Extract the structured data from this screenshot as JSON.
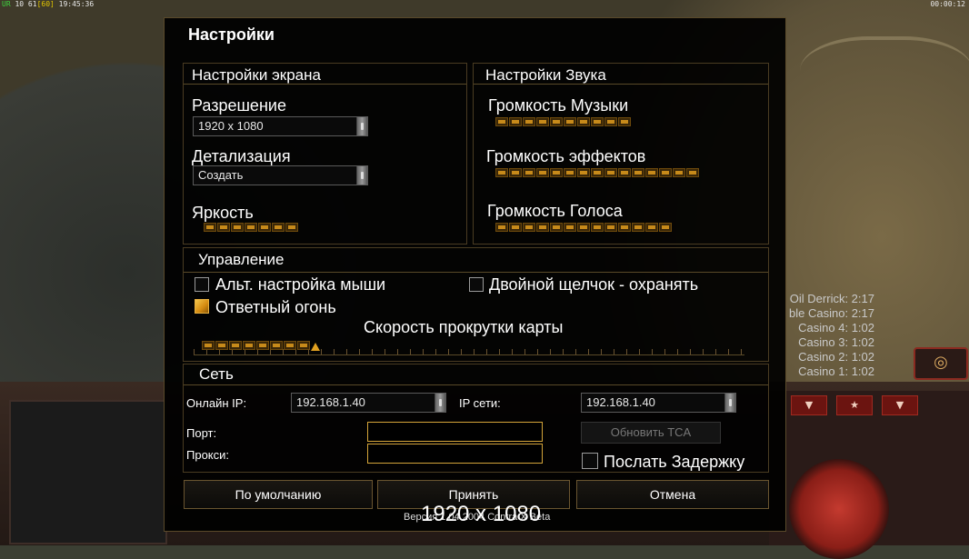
{
  "hud": {
    "status_left_prefix": "UR",
    "status_left_mid": "10 61",
    "status_left_fps": "[60]",
    "status_left_time": "19:45:36",
    "status_right_time": "00:00:12",
    "timers": [
      "Oil Derrick: 2:17",
      "ble Casino: 2:17",
      "Casino 4: 1:02",
      "Casino 3: 1:02",
      "Casino 2: 1:02",
      "Casino 1: 1:02"
    ]
  },
  "dialog": {
    "title": "Настройки",
    "screen": {
      "title": "Настройки экрана",
      "resolution_label": "Разрешение",
      "resolution_value": "1920 x 1080",
      "detail_label": "Детализация",
      "detail_value": "Создать",
      "brightness_label": "Яркость",
      "brightness_level": 7
    },
    "sound": {
      "title": "Настройки Звука",
      "music_label": "Громкость Музыки",
      "music_level": 10,
      "effects_label": "Громкость эффектов",
      "effects_level": 15,
      "voice_label": "Громкость Голоса",
      "voice_level": 13
    },
    "control": {
      "title": "Управление",
      "alt_mouse_label": "Альт. настройка мыши",
      "alt_mouse_checked": false,
      "double_click_label": "Двойной щелчок - охранять",
      "double_click_checked": false,
      "return_fire_label": "Ответный огонь",
      "return_fire_checked": true,
      "scroll_speed_label": "Скорость прокрутки карты",
      "scroll_speed_level": 8
    },
    "network": {
      "title": "Сеть",
      "online_ip_label": "Онлайн IP:",
      "online_ip_value": "192.168.1.40",
      "lan_ip_label": "IP сети:",
      "lan_ip_value": "192.168.1.40",
      "port_label": "Порт:",
      "port_value": "",
      "proxy_label": "Прокси:",
      "proxy_value": "",
      "update_tca_label": "Обновить TCA",
      "send_delay_label": "Послать Задержку",
      "send_delay_checked": false
    },
    "buttons": {
      "default_label": "По умолчанию",
      "accept_label": "Принять",
      "cancel_label": "Отмена"
    },
    "version_text": "Версия 1.04 2004 Contra X Beta",
    "resolution_overlay": "1920 x 1080"
  }
}
